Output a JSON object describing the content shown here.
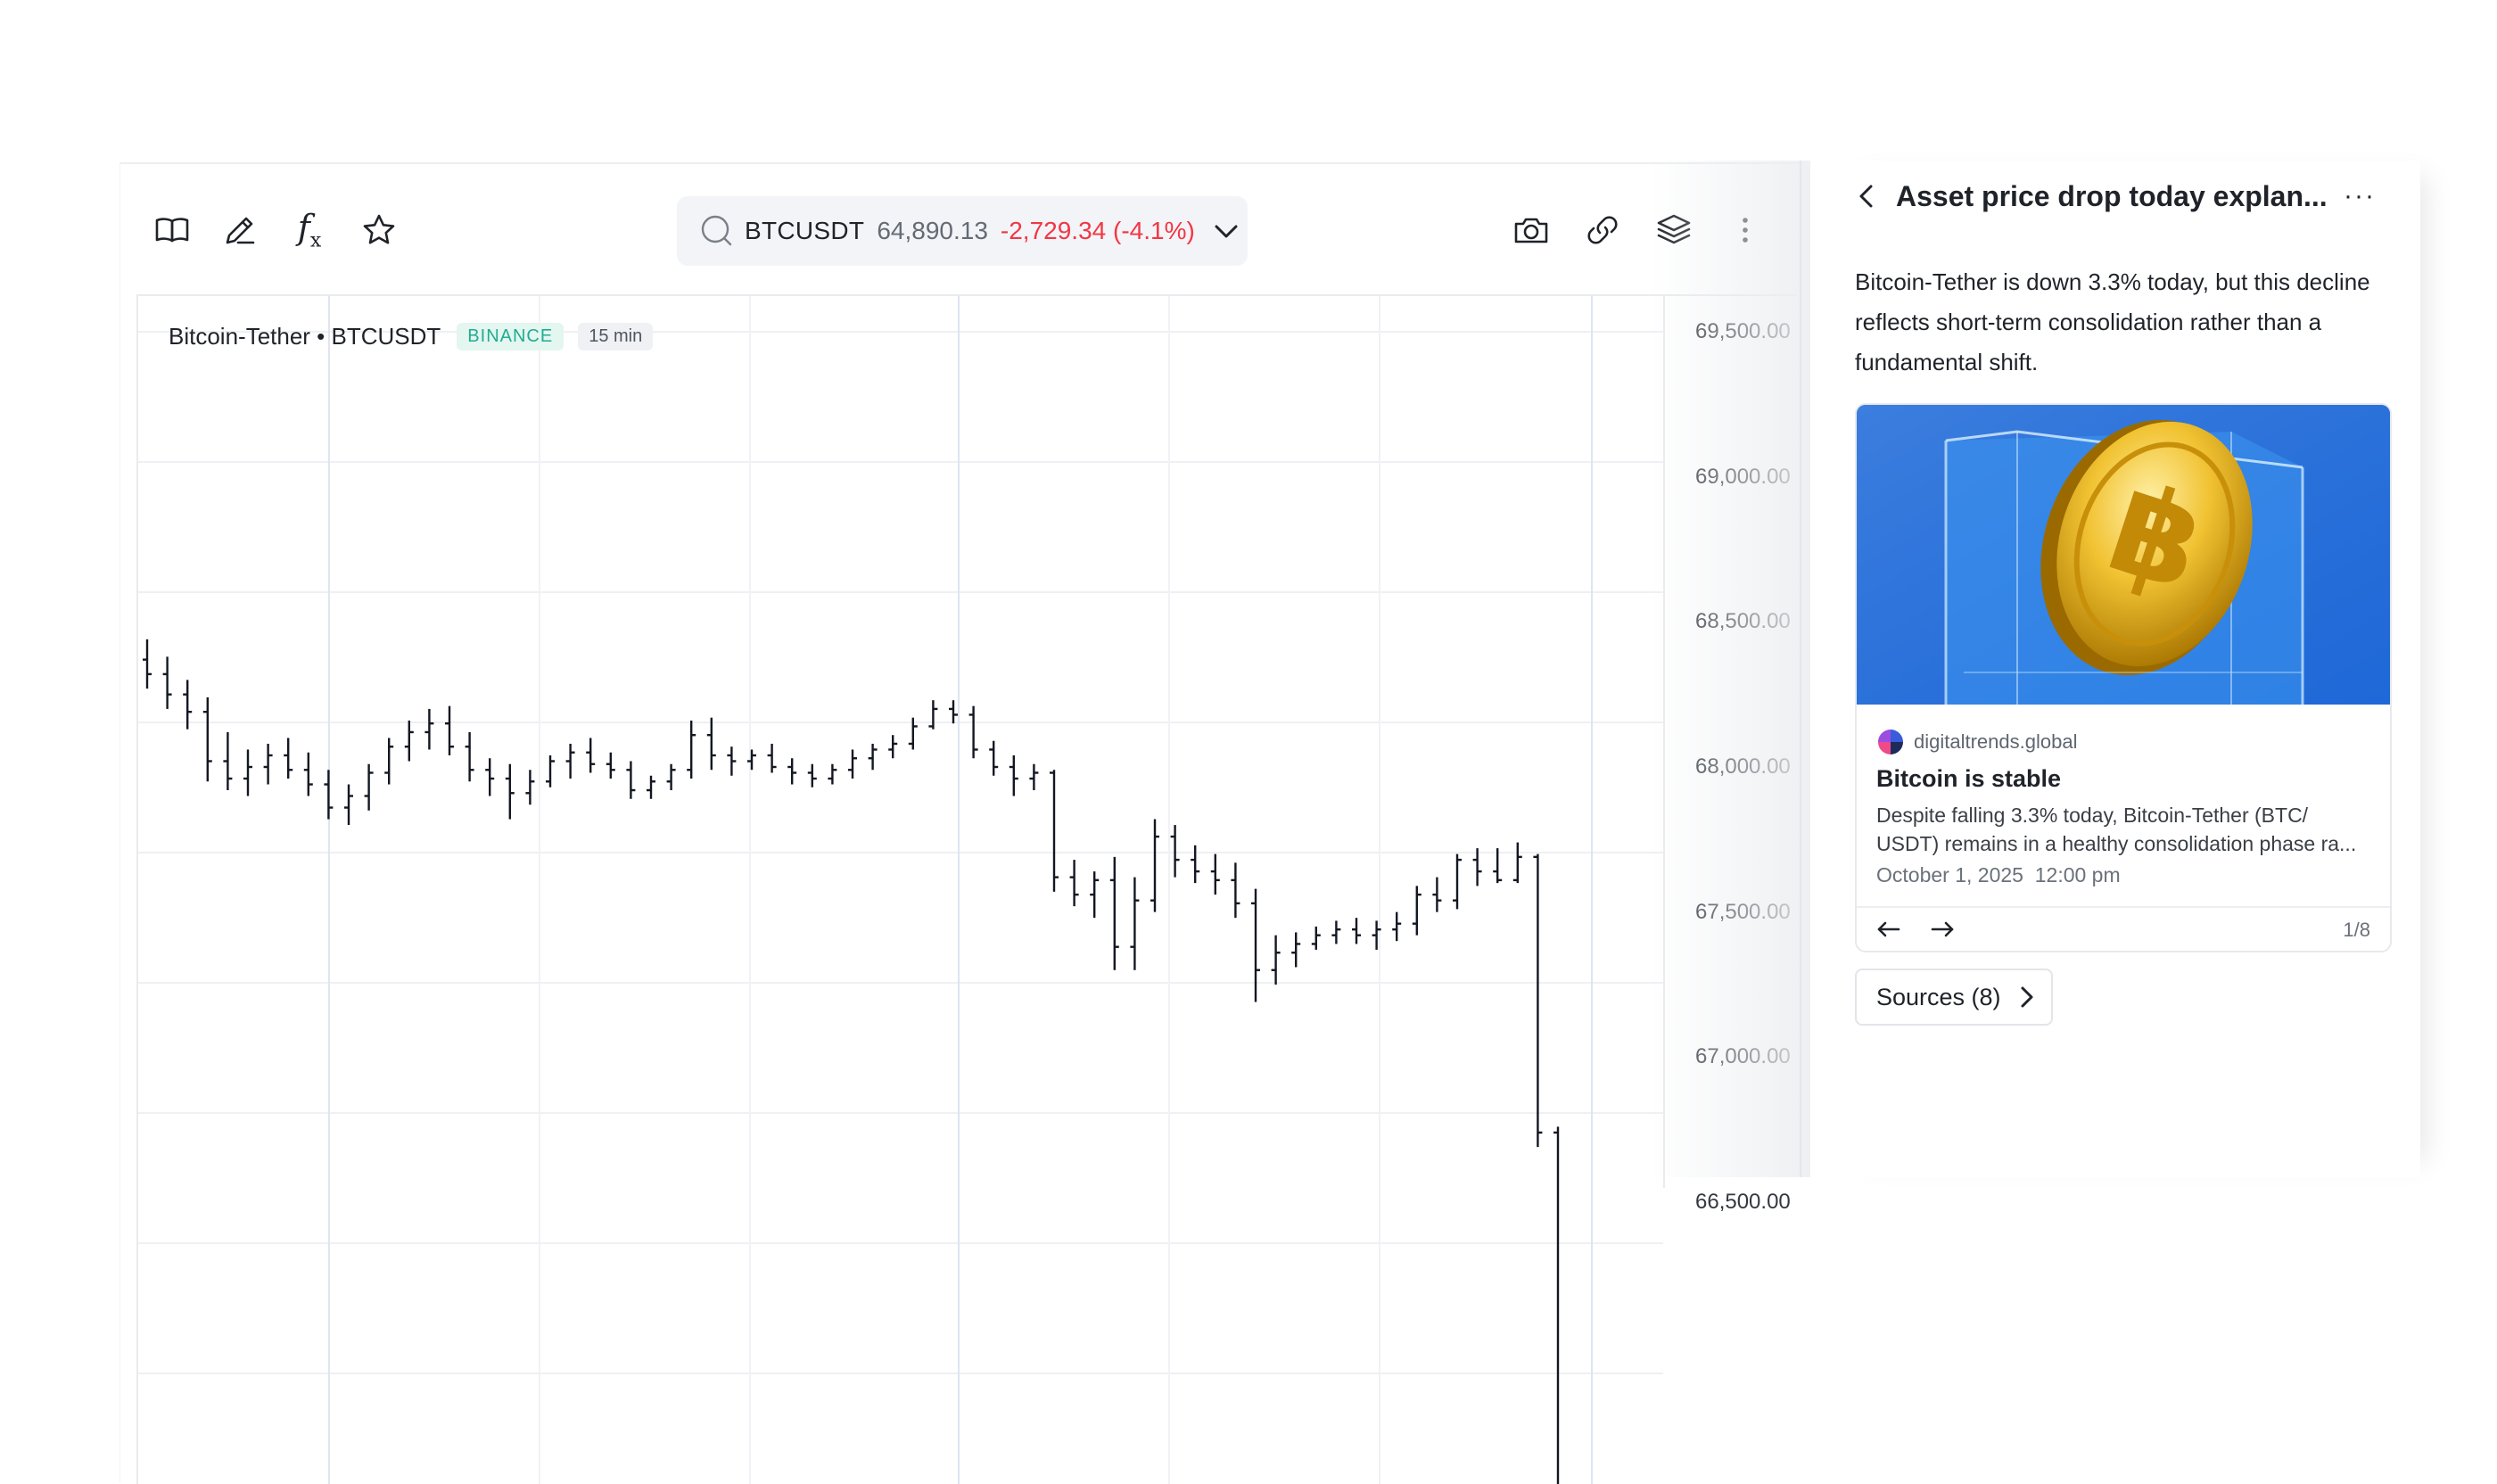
{
  "toolbar": {
    "left_icons": [
      "book-icon",
      "pencil-icon",
      "function-icon",
      "star-icon"
    ],
    "right_icons": [
      "camera-icon",
      "link-icon",
      "layers-icon",
      "more-vertical-icon"
    ],
    "function_label": "f",
    "function_sub": "x"
  },
  "symbol": {
    "ticker": "BTCUSDT",
    "price": "64,890.13",
    "change": "-2,729.34 (-4.1%)",
    "change_color": "#f23645"
  },
  "legend": {
    "name": "Bitcoin-Tether • BTCUSDT",
    "exchange": "BINANCE",
    "interval": "15 min"
  },
  "chart_data": {
    "type": "ohlc",
    "interval": "15 min",
    "ylim": [
      65300,
      69600
    ],
    "price_axis_labels": [
      "69,500.00",
      "69,000.00",
      "68,500.00",
      "68,000.00",
      "67,500.00",
      "67,000.00",
      "66,500.00"
    ],
    "price_axis_values": [
      69500,
      69000,
      68500,
      68000,
      67500,
      67000,
      66500
    ],
    "bars": [
      [
        68370,
        68440,
        68270,
        68320
      ],
      [
        68320,
        68380,
        68200,
        68250
      ],
      [
        68250,
        68300,
        68130,
        68190
      ],
      [
        68190,
        68240,
        67950,
        68020
      ],
      [
        68020,
        68120,
        67920,
        67960
      ],
      [
        67960,
        68060,
        67900,
        68000
      ],
      [
        68000,
        68080,
        67940,
        68040
      ],
      [
        68040,
        68100,
        67960,
        67990
      ],
      [
        67990,
        68050,
        67900,
        67940
      ],
      [
        67940,
        67990,
        67820,
        67860
      ],
      [
        67860,
        67940,
        67800,
        67900
      ],
      [
        67900,
        68010,
        67850,
        67980
      ],
      [
        67980,
        68100,
        67940,
        68070
      ],
      [
        68070,
        68160,
        68020,
        68120
      ],
      [
        68120,
        68200,
        68060,
        68150
      ],
      [
        68150,
        68210,
        68040,
        68070
      ],
      [
        68070,
        68120,
        67950,
        67990
      ],
      [
        67990,
        68030,
        67900,
        67960
      ],
      [
        67960,
        68010,
        67820,
        67910
      ],
      [
        67910,
        67990,
        67870,
        67950
      ],
      [
        67950,
        68040,
        67930,
        68020
      ],
      [
        68020,
        68080,
        67960,
        68050
      ],
      [
        68050,
        68100,
        67980,
        68010
      ],
      [
        68010,
        68050,
        67960,
        67990
      ],
      [
        67990,
        68020,
        67890,
        67920
      ],
      [
        67920,
        67970,
        67890,
        67950
      ],
      [
        67950,
        68010,
        67920,
        67990
      ],
      [
        67990,
        68160,
        67960,
        68110
      ],
      [
        68110,
        68170,
        67990,
        68040
      ],
      [
        68040,
        68070,
        67970,
        68020
      ],
      [
        68020,
        68060,
        67990,
        68040
      ],
      [
        68040,
        68080,
        67980,
        68000
      ],
      [
        68000,
        68030,
        67940,
        67980
      ],
      [
        67980,
        68010,
        67930,
        67960
      ],
      [
        67960,
        68010,
        67940,
        67990
      ],
      [
        67990,
        68060,
        67960,
        68030
      ],
      [
        68030,
        68080,
        67990,
        68060
      ],
      [
        68060,
        68110,
        68030,
        68080
      ],
      [
        68080,
        68170,
        68060,
        68140
      ],
      [
        68140,
        68230,
        68130,
        68200
      ],
      [
        68200,
        68230,
        68150,
        68180
      ],
      [
        68180,
        68210,
        68030,
        68060
      ],
      [
        68060,
        68090,
        67970,
        68000
      ],
      [
        68000,
        68040,
        67900,
        67960
      ],
      [
        67960,
        68010,
        67920,
        67980
      ],
      [
        67980,
        67990,
        67570,
        67620
      ],
      [
        67620,
        67680,
        67520,
        67560
      ],
      [
        67560,
        67640,
        67480,
        67610
      ],
      [
        67610,
        67690,
        67300,
        67380
      ],
      [
        67380,
        67620,
        67300,
        67540
      ],
      [
        67540,
        67820,
        67500,
        67760
      ],
      [
        67760,
        67800,
        67620,
        67680
      ],
      [
        67680,
        67730,
        67600,
        67640
      ],
      [
        67640,
        67700,
        67560,
        67610
      ],
      [
        67610,
        67670,
        67480,
        67530
      ],
      [
        67530,
        67580,
        67190,
        67300
      ],
      [
        67300,
        67420,
        67250,
        67360
      ],
      [
        67360,
        67430,
        67310,
        67390
      ],
      [
        67390,
        67450,
        67370,
        67420
      ],
      [
        67420,
        67470,
        67390,
        67440
      ],
      [
        67440,
        67480,
        67390,
        67420
      ],
      [
        67420,
        67470,
        67370,
        67440
      ],
      [
        67440,
        67500,
        67400,
        67460
      ],
      [
        67460,
        67590,
        67420,
        67560
      ],
      [
        67560,
        67620,
        67500,
        67540
      ],
      [
        67540,
        67700,
        67510,
        67680
      ],
      [
        67680,
        67720,
        67590,
        67640
      ],
      [
        67640,
        67720,
        67600,
        67610
      ],
      [
        67610,
        67740,
        67600,
        67690
      ],
      [
        67690,
        67700,
        66690,
        66740
      ],
      [
        66740,
        66760,
        65350,
        65380
      ]
    ]
  },
  "panel": {
    "title": "Asset price drop today explan...",
    "more_label": "···",
    "summary": "Bitcoin-Tether is down 3.3% today, but this decline reflects short-term consolidation rather than a fundamental shift.",
    "card": {
      "image": "bitcoin-in-ice-cube-image",
      "source": "digitaltrends.global",
      "title": "Bitcoin is stable",
      "excerpt": "Despite falling 3.3% today, Bitcoin-Tether (BTC/ USDT) remains in a healthy consolidation phase ra...",
      "date": "October 1, 2025",
      "time": "12:00 pm",
      "pager": "1/8"
    },
    "sources_label": "Sources (8)"
  }
}
